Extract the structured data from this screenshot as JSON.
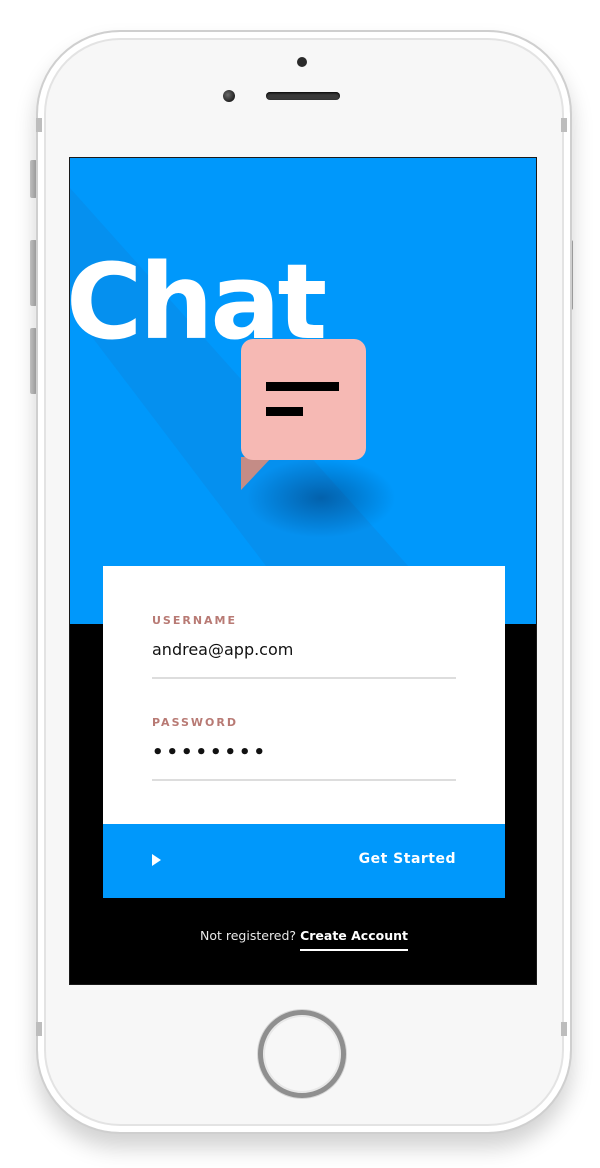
{
  "app": {
    "title": "Chat"
  },
  "login": {
    "username_label": "USERNAME",
    "username_value": "andrea@app.com",
    "password_label": "PASSWORD",
    "password_value": "••••••••",
    "submit_icon": "play-icon",
    "submit_label": "Get Started"
  },
  "footer": {
    "prompt": "Not registered?",
    "link_label": "Create Account"
  },
  "colors": {
    "accent": "#0098fb",
    "bubble": "#f6b9b4",
    "label": "#b87a74",
    "background_lower": "#000000"
  }
}
